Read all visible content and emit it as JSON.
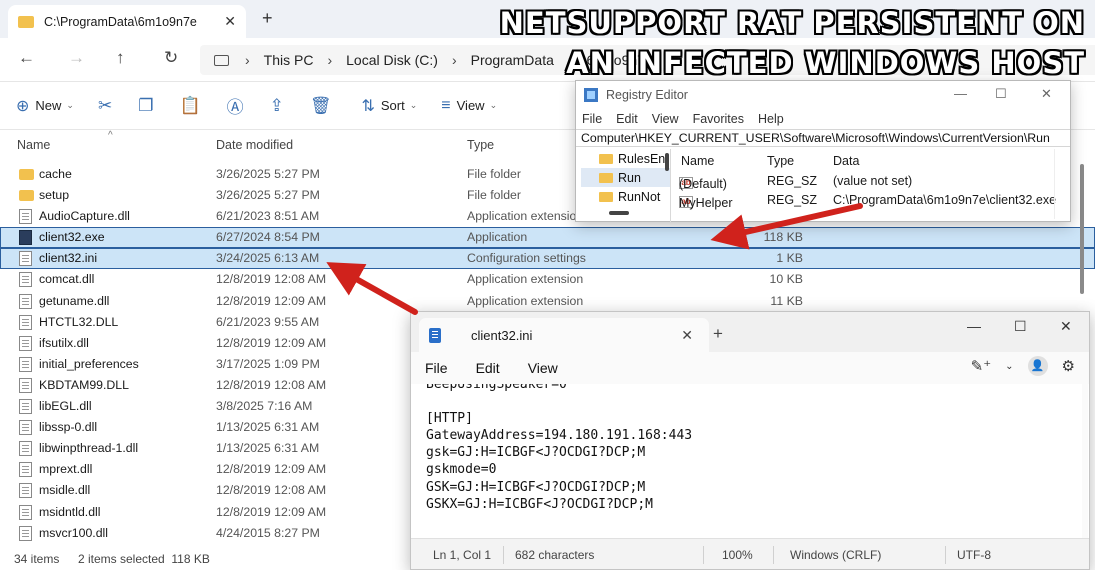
{
  "headline": {
    "line1": "NETSUPPORT RAT PERSISTENT ON",
    "line2": "AN INFECTED WINDOWS HOST"
  },
  "explorer": {
    "tab_title": "C:\\ProgramData\\6m1o9n7e",
    "breadcrumb": [
      "This PC",
      "Local Disk (C:)",
      "ProgramData",
      "6m1o9n7e"
    ],
    "toolbar": {
      "new": "New",
      "sort": "Sort",
      "view": "View"
    },
    "columns": {
      "name": "Name",
      "date": "Date modified",
      "type": "Type"
    },
    "files": [
      {
        "name": "cache",
        "date": "3/26/2025 5:27 PM",
        "type": "File folder",
        "size": "",
        "icon": "folder-icon"
      },
      {
        "name": "setup",
        "date": "3/26/2025 5:27 PM",
        "type": "File folder",
        "size": "",
        "icon": "folder-icon"
      },
      {
        "name": "AudioCapture.dll",
        "date": "6/21/2023 8:51 AM",
        "type": "Application extension",
        "size": "",
        "icon": "dll-file-icon"
      },
      {
        "name": "client32.exe",
        "date": "6/27/2024 8:54 PM",
        "type": "Application",
        "size": "118 KB",
        "icon": "exe-file-icon"
      },
      {
        "name": "client32.ini",
        "date": "3/24/2025 6:13 AM",
        "type": "Configuration settings",
        "size": "1 KB",
        "icon": "ini-file-icon"
      },
      {
        "name": "comcat.dll",
        "date": "12/8/2019 12:08 AM",
        "type": "Application extension",
        "size": "10 KB",
        "icon": "dll-file-icon"
      },
      {
        "name": "getuname.dll",
        "date": "12/8/2019 12:09 AM",
        "type": "Application extension",
        "size": "11 KB",
        "icon": "dll-file-icon"
      },
      {
        "name": "HTCTL32.DLL",
        "date": "6/21/2023 9:55 AM",
        "type": "",
        "size": "",
        "icon": "dll-file-icon"
      },
      {
        "name": "ifsutilx.dll",
        "date": "12/8/2019 12:09 AM",
        "type": "",
        "size": "",
        "icon": "dll-file-icon"
      },
      {
        "name": "initial_preferences",
        "date": "3/17/2025 1:09 PM",
        "type": "",
        "size": "",
        "icon": "file-icon"
      },
      {
        "name": "KBDTAM99.DLL",
        "date": "12/8/2019 12:08 AM",
        "type": "",
        "size": "",
        "icon": "dll-file-icon"
      },
      {
        "name": "libEGL.dll",
        "date": "3/8/2025 7:16 AM",
        "type": "",
        "size": "",
        "icon": "dll-file-icon"
      },
      {
        "name": "libssp-0.dll",
        "date": "1/13/2025 6:31 AM",
        "type": "",
        "size": "",
        "icon": "dll-file-icon"
      },
      {
        "name": "libwinpthread-1.dll",
        "date": "1/13/2025 6:31 AM",
        "type": "",
        "size": "",
        "icon": "dll-file-icon"
      },
      {
        "name": "mprext.dll",
        "date": "12/8/2019 12:09 AM",
        "type": "",
        "size": "",
        "icon": "dll-file-icon"
      },
      {
        "name": "msidle.dll",
        "date": "12/8/2019 12:08 AM",
        "type": "",
        "size": "",
        "icon": "dll-file-icon"
      },
      {
        "name": "msidntld.dll",
        "date": "12/8/2019 12:09 AM",
        "type": "",
        "size": "",
        "icon": "dll-file-icon"
      },
      {
        "name": "msvcr100.dll",
        "date": "4/24/2015 8:27 PM",
        "type": "",
        "size": "",
        "icon": "dll-file-icon"
      }
    ],
    "selected_rows": [
      3,
      4
    ],
    "status": {
      "items": "34 items",
      "selected": "2 items selected  118 KB"
    }
  },
  "regedit": {
    "title": "Registry Editor",
    "menu": [
      "File",
      "Edit",
      "View",
      "Favorites",
      "Help"
    ],
    "path": "Computer\\HKEY_CURRENT_USER\\Software\\Microsoft\\Windows\\CurrentVersion\\Run",
    "tree": [
      "RulesEn",
      "Run",
      "RunNot"
    ],
    "tree_selected": 1,
    "columns": {
      "name": "Name",
      "type": "Type",
      "data": "Data"
    },
    "values": [
      {
        "name": "(Default)",
        "type": "REG_SZ",
        "data": "(value not set)"
      },
      {
        "name": "MyHelper",
        "type": "REG_SZ",
        "data": "C:\\ProgramData\\6m1o9n7e\\client32.exe"
      }
    ]
  },
  "notepad": {
    "tab_title": "client32.ini",
    "menu": [
      "File",
      "Edit",
      "View"
    ],
    "lines": [
      "BeepUsingSpeaker=0",
      "",
      "[HTTP]",
      "GatewayAddress=194.180.191.168:443",
      "gsk=GJ:H=ICBGF<J?OCDGI?DCP;M",
      "gskmode=0",
      "GSK=GJ:H=ICBGF<J?OCDGI?DCP;M",
      "GSKX=GJ:H=ICBGF<J?OCDGI?DCP;M"
    ],
    "status": {
      "position": "Ln 1, Col 1",
      "chars": "682 characters",
      "zoom": "100%",
      "line_ending": "Windows (CRLF)",
      "encoding": "UTF-8"
    }
  },
  "colors": {
    "arrow": "#d0221c",
    "selection": "#cce4f7",
    "selection_border": "#2b5f9e"
  }
}
